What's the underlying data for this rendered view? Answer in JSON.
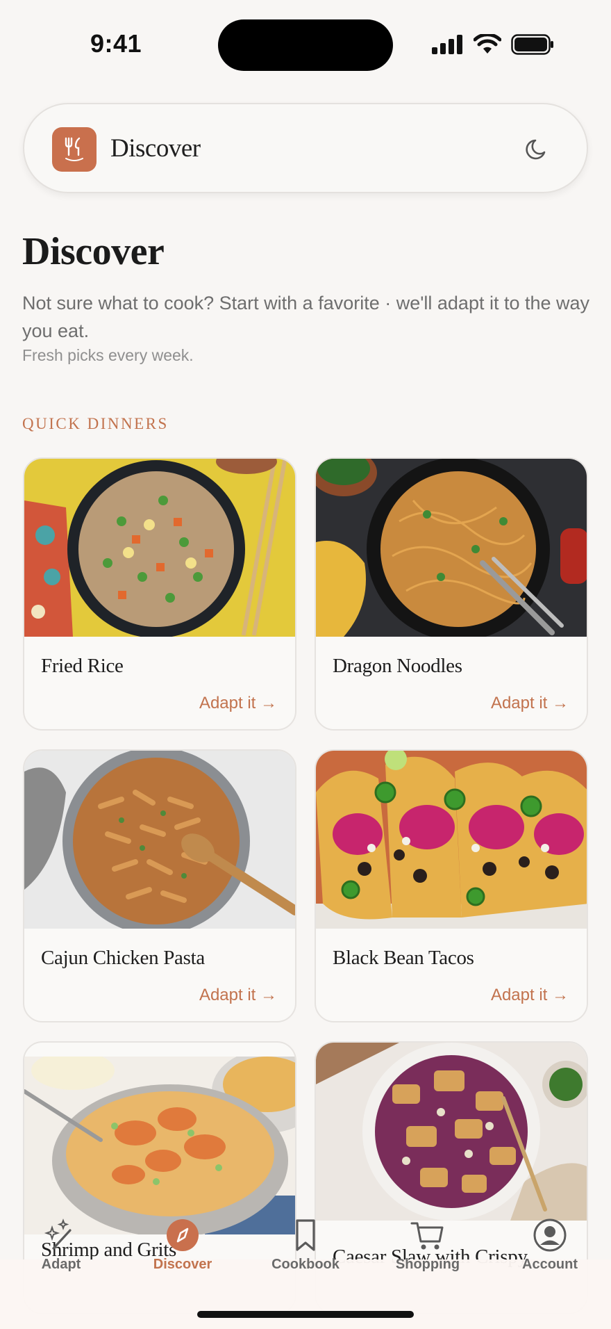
{
  "status": {
    "time": "9:41"
  },
  "header": {
    "title": "Discover"
  },
  "hero": {
    "title": "Discover",
    "subtitle": "Not sure what to cook? Start with a favorite · we'll adapt it to the way you eat.",
    "note": "Fresh picks every week."
  },
  "section": {
    "label": "QUICK DINNERS"
  },
  "recipes": [
    {
      "title": "Fried Rice",
      "cta": "Adapt it →"
    },
    {
      "title": "Dragon Noodles",
      "cta": "Adapt it →"
    },
    {
      "title": "Cajun Chicken Pasta",
      "cta": "Adapt it →"
    },
    {
      "title": "Black Bean Tacos",
      "cta": "Adapt it →"
    },
    {
      "title": "Shrimp and Grits"
    },
    {
      "title": "Caesar Slaw with Crispy"
    }
  ],
  "tabs": [
    {
      "label": "Adapt",
      "icon": "magic-wand-icon"
    },
    {
      "label": "Discover",
      "icon": "compass-icon"
    },
    {
      "label": "Cookbook",
      "icon": "bookmark-icon"
    },
    {
      "label": "Shopping",
      "icon": "cart-icon"
    },
    {
      "label": "Account",
      "icon": "user-circle-icon"
    }
  ],
  "colors": {
    "accent": "#c2734e",
    "logo": "#c9704d",
    "background": "#f8f6f4"
  }
}
